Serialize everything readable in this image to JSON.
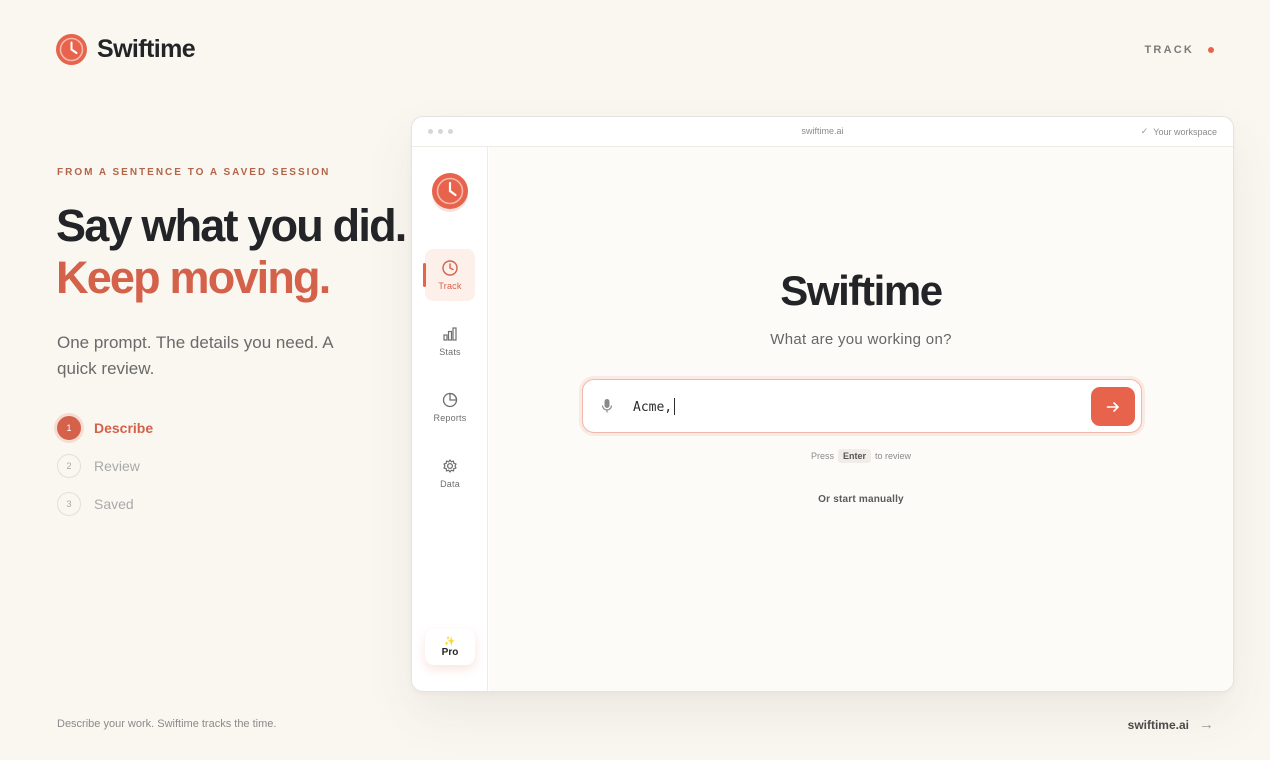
{
  "brand": {
    "name": "Swiftime"
  },
  "top_nav": {
    "label": "TRACK"
  },
  "hero": {
    "eyebrow": "FROM A SENTENCE TO A SAVED SESSION",
    "headline_line1": "Say what you did.",
    "headline_line2": "Keep moving.",
    "lede": "One prompt. The details you need. A quick review."
  },
  "steps": [
    {
      "number": "1",
      "label": "Describe",
      "active": true
    },
    {
      "number": "2",
      "label": "Review",
      "active": false
    },
    {
      "number": "3",
      "label": "Saved",
      "active": false
    }
  ],
  "footer": {
    "note": "Describe your work. Swiftime tracks the time.",
    "link": "swiftime.ai",
    "link_arrow": "→"
  },
  "window": {
    "url": "swiftime.ai",
    "workspace": "Your workspace",
    "sidebar": {
      "items": [
        {
          "label": "Track",
          "icon": "clock-icon",
          "active": true
        },
        {
          "label": "Stats",
          "icon": "bar-chart-icon",
          "active": false
        },
        {
          "label": "Reports",
          "icon": "pie-chart-icon",
          "active": false
        },
        {
          "label": "Data",
          "icon": "gear-icon",
          "active": false
        }
      ],
      "pro_label": "Pro",
      "pro_icon": "sparkle-icon"
    },
    "main": {
      "title": "Swiftime",
      "subtitle": "What are you working on?",
      "prompt_value": "Acme,",
      "hint_prefix": "Press",
      "hint_key": "Enter",
      "hint_suffix": "to review",
      "manual_link": "Or start manually"
    }
  },
  "colors": {
    "accent": "#e8634b",
    "accent_text": "#d4614a",
    "background": "#faf7f1",
    "text": "#232427"
  }
}
